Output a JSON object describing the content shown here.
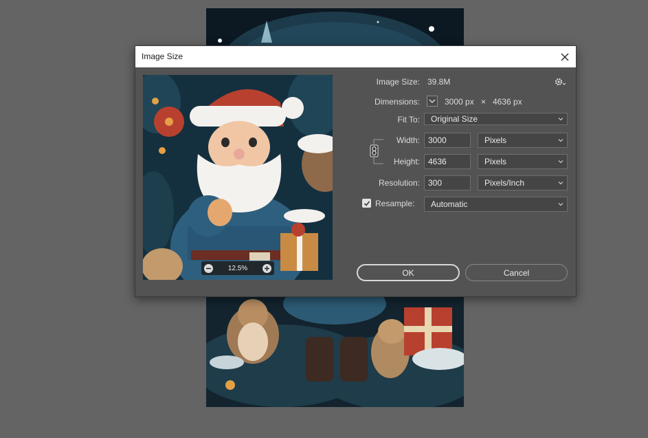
{
  "dialog": {
    "title": "Image Size",
    "image_size_label": "Image Size:",
    "image_size_value": "39.8M",
    "dimensions_label": "Dimensions:",
    "dimensions_width": "3000 px",
    "dimensions_times": "×",
    "dimensions_height": "4636 px",
    "fit_to_label": "Fit To:",
    "fit_to_value": "Original Size",
    "width_label": "Width:",
    "width_value": "3000",
    "width_unit": "Pixels",
    "height_label": "Height:",
    "height_value": "4636",
    "height_unit": "Pixels",
    "resolution_label": "Resolution:",
    "resolution_value": "300",
    "resolution_unit": "Pixels/Inch",
    "resample_label": "Resample:",
    "resample_checked": true,
    "resample_value": "Automatic",
    "ok_label": "OK",
    "cancel_label": "Cancel",
    "zoom_value": "12.5%"
  }
}
